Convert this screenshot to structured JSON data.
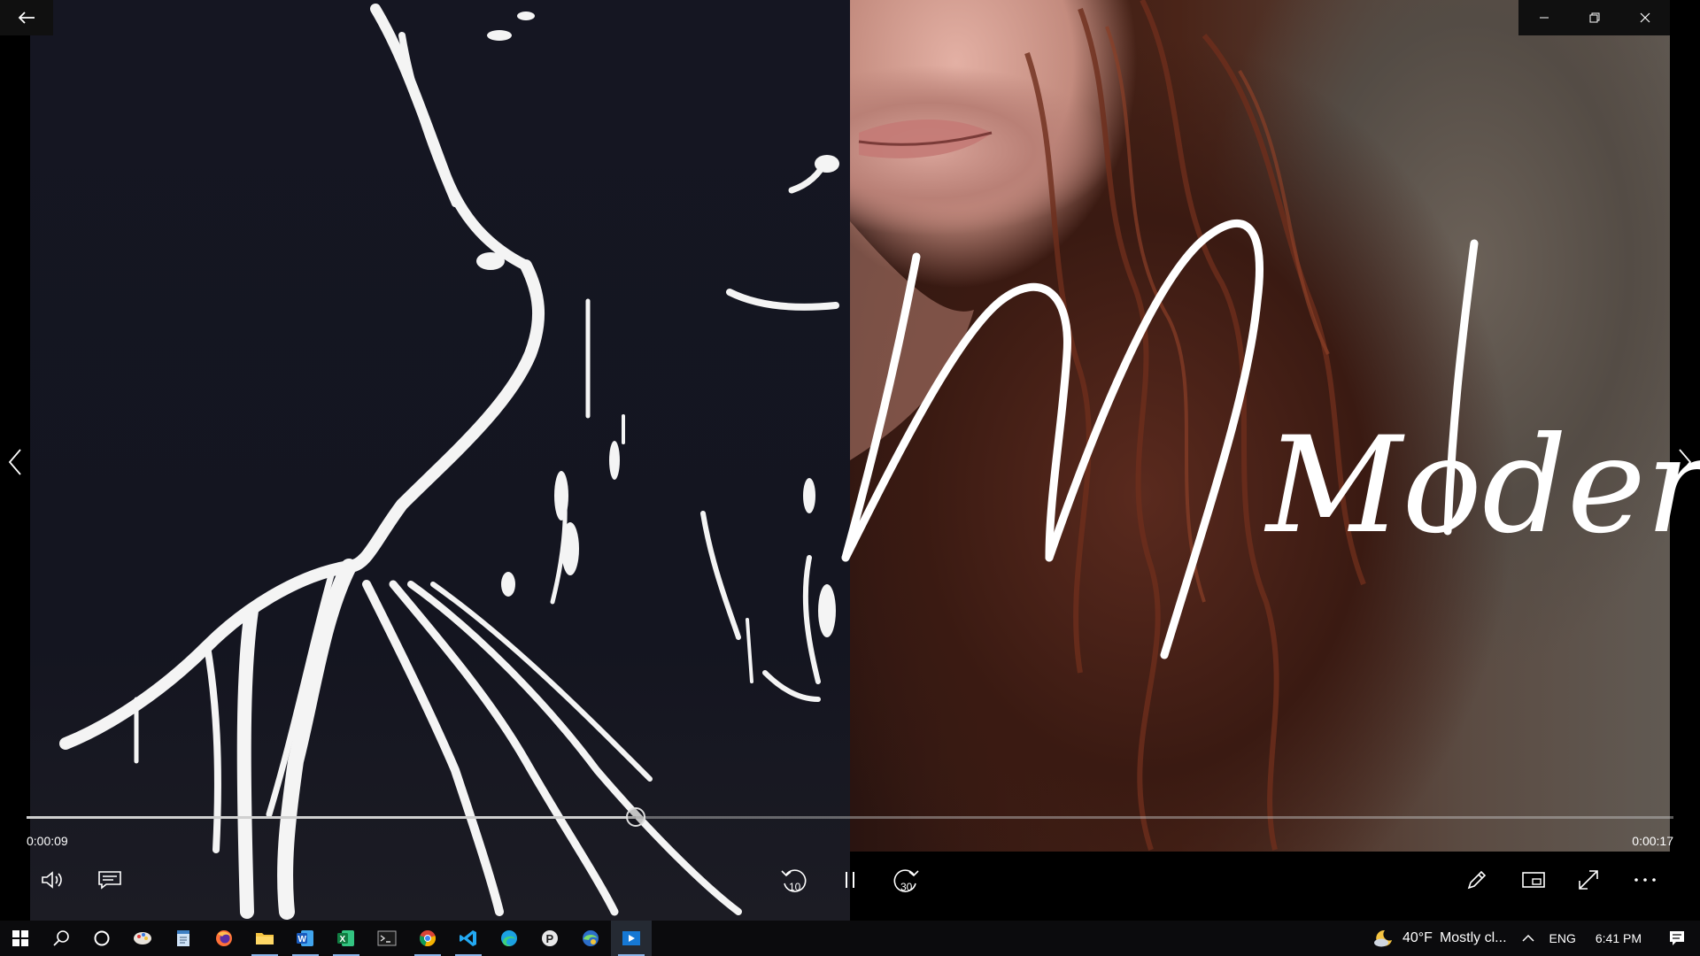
{
  "window": {
    "back_icon": "arrow-left-icon",
    "minimize_icon": "minimize-icon",
    "restore_icon": "restore-icon",
    "close_icon": "close-icon"
  },
  "media": {
    "overlay_text": "Modern",
    "prev_icon": "chevron-left-icon",
    "next_icon": "chevron-right-icon"
  },
  "player": {
    "elapsed": "0:00:09",
    "total": "0:00:17",
    "progress_fraction": 0.37,
    "controls": {
      "volume_icon": "volume-icon",
      "captions_icon": "captions-icon",
      "skip_back_icon": "skip-back-10-icon",
      "skip_back_value": "10",
      "play_pause_icon": "pause-icon",
      "skip_forward_icon": "skip-forward-30-icon",
      "skip_forward_value": "30",
      "edit_icon": "pencil-icon",
      "mini_view_icon": "mini-view-icon",
      "fullscreen_icon": "fullscreen-icon",
      "more_icon": "more-icon"
    }
  },
  "taskbar": {
    "apps": [
      {
        "name": "start",
        "icon": "windows-icon"
      },
      {
        "name": "search",
        "icon": "search-icon"
      },
      {
        "name": "cortana",
        "icon": "cortana-icon"
      },
      {
        "name": "paint",
        "icon": "paint-icon"
      },
      {
        "name": "notepad",
        "icon": "notepad-icon"
      },
      {
        "name": "firefox",
        "icon": "firefox-icon"
      },
      {
        "name": "file-explorer",
        "icon": "folder-icon"
      },
      {
        "name": "word",
        "icon": "word-icon"
      },
      {
        "name": "excel",
        "icon": "excel-icon"
      },
      {
        "name": "terminal",
        "icon": "terminal-icon"
      },
      {
        "name": "chrome",
        "icon": "chrome-icon"
      },
      {
        "name": "vscode",
        "icon": "vscode-icon"
      },
      {
        "name": "edge",
        "icon": "edge-icon"
      },
      {
        "name": "app-p",
        "icon": "p-app-icon"
      },
      {
        "name": "edge-dev",
        "icon": "edge-dev-icon"
      },
      {
        "name": "video-player",
        "icon": "video-player-icon"
      }
    ],
    "weather": {
      "temp": "40°F",
      "desc": "Mostly cl...",
      "icon": "moon-cloud-icon"
    },
    "tray_chevron": "chevron-up-icon",
    "language": "ENG",
    "clock": "6:41 PM",
    "notifications_icon": "notification-icon"
  }
}
